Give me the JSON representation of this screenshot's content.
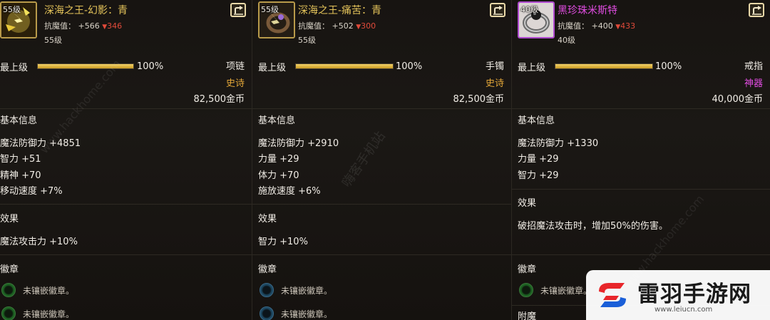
{
  "panels": [
    {
      "icon": "lightning-necklace-icon",
      "level_badge": "55级",
      "name": "深海之王-幻影：青",
      "resist_label": "抗魔值：",
      "resist_up": "+566",
      "resist_down": "346",
      "req_level": "55级",
      "grade_label": "最上级",
      "grade_pct": "100%",
      "grade_fraction": 1.0,
      "slot_type": "项链",
      "rarity": "史诗",
      "price": "82,500金币",
      "basic_title": "基本信息",
      "stats": [
        "魔法防御力 +4851",
        "智力 +51",
        "精神 +70",
        "移动速度 +7%"
      ],
      "effect_title": "效果",
      "effects": [
        "魔法攻击力 +10%"
      ],
      "emblem_title": "徽章",
      "sockets": [
        {
          "color": "green",
          "text": "未镶嵌徽章。"
        },
        {
          "color": "green",
          "text": "未镶嵌徽章。"
        }
      ]
    },
    {
      "icon": "lightning-bracelet-icon",
      "level_badge": "55级",
      "name": "深海之王-痛苦：青",
      "resist_label": "抗魔值：",
      "resist_up": "+502",
      "resist_down": "300",
      "req_level": "55级",
      "grade_label": "最上级",
      "grade_pct": "100%",
      "grade_fraction": 1.0,
      "slot_type": "手镯",
      "rarity": "史诗",
      "price": "82,500金币",
      "basic_title": "基本信息",
      "stats": [
        "魔法防御力 +2910",
        "力量 +29",
        "体力 +70",
        "施放速度 +6%"
      ],
      "effect_title": "效果",
      "effects": [
        "智力 +10%"
      ],
      "emblem_title": "徽章",
      "sockets": [
        {
          "color": "blue",
          "text": "未镶嵌徽章。"
        },
        {
          "color": "blue",
          "text": "未镶嵌徽章。"
        }
      ]
    },
    {
      "icon": "pearl-ring-icon",
      "level_badge": "40级",
      "name": "黑珍珠米斯特",
      "resist_label": "抗魔值：",
      "resist_up": "+400",
      "resist_down": "433",
      "req_level": "40级",
      "grade_label": "最上级",
      "grade_pct": "100%",
      "grade_fraction": 1.0,
      "slot_type": "戒指",
      "rarity": "神器",
      "price": "40,000金币",
      "basic_title": "基本信息",
      "stats": [
        "魔法防御力 +1330",
        "力量 +29",
        "智力 +29"
      ],
      "effect_title": "效果",
      "effects": [
        "破招魔法攻击时，增加50%的伤害。"
      ],
      "emblem_title": "徽章",
      "sockets": [
        {
          "color": "green",
          "text": "未镶嵌徽章。"
        }
      ],
      "enchant_title": "附魔"
    }
  ],
  "watermarks": {
    "left": "www.hackhome.com",
    "middle": "嗨客手机站",
    "right": "www.hackhome.com"
  },
  "logo": {
    "title": "雷羽手游网",
    "url": "www.leiucn.com"
  },
  "colors": {
    "gold_name": "#e4c35a",
    "artifact_name": "#e04ce0",
    "epic_rarity": "#e2a638",
    "resist_down": "#e04a3a"
  }
}
